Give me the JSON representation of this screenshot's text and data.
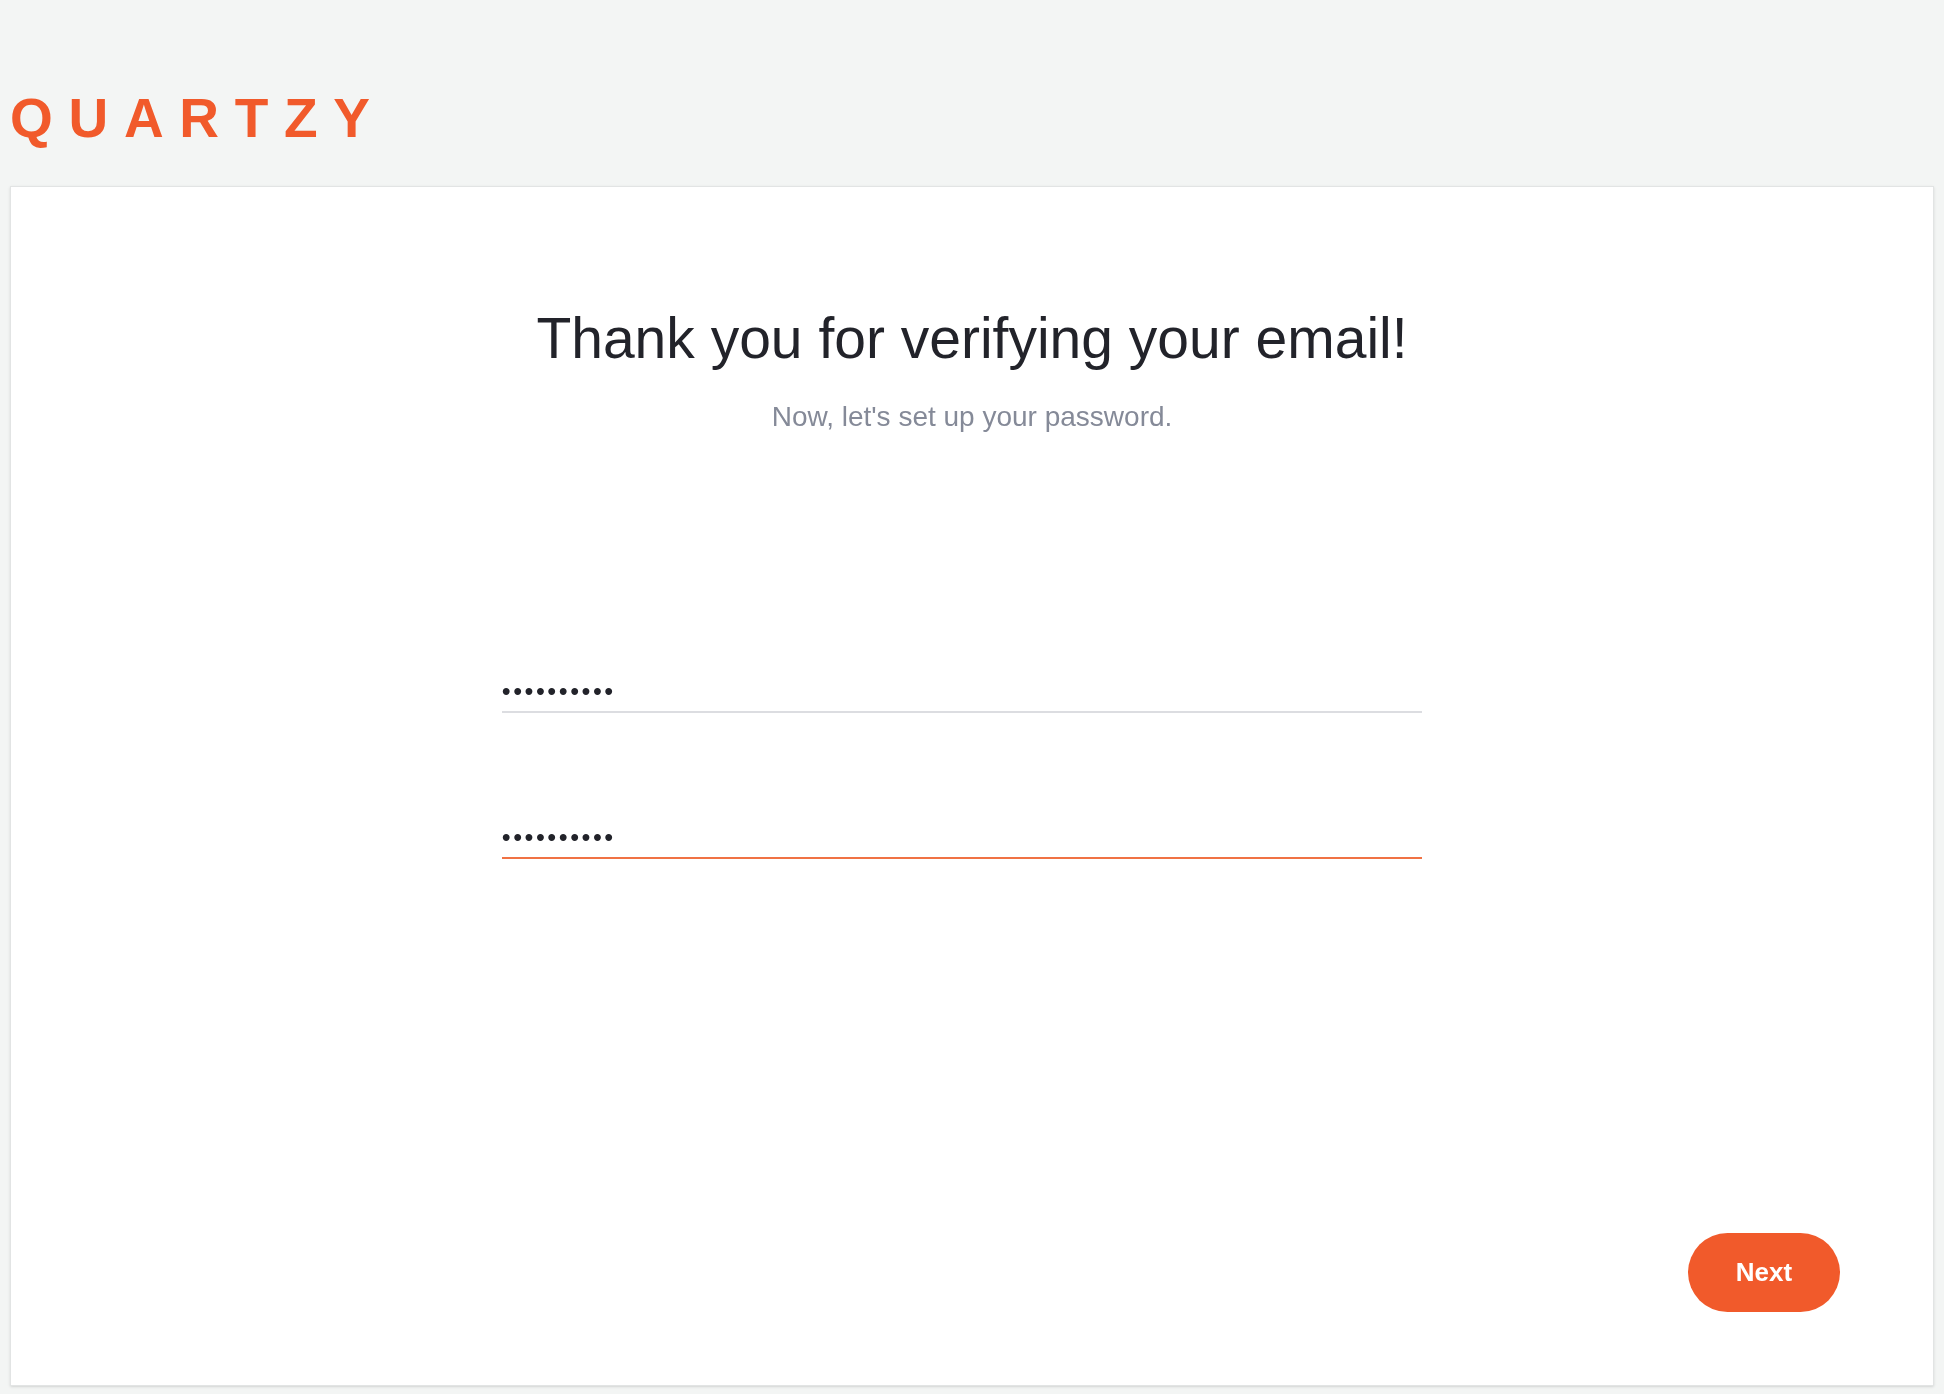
{
  "logo": {
    "text": "QUARTZY"
  },
  "card": {
    "heading": "Thank you for verifying your email!",
    "subheading": "Now, let's set up your password.",
    "fields": [
      {
        "kind": "password",
        "value": "••••••••••",
        "focused": false
      },
      {
        "kind": "password",
        "value": "••••••••••",
        "focused": true
      }
    ],
    "buttons": [
      {
        "label": "Next"
      }
    ]
  }
}
